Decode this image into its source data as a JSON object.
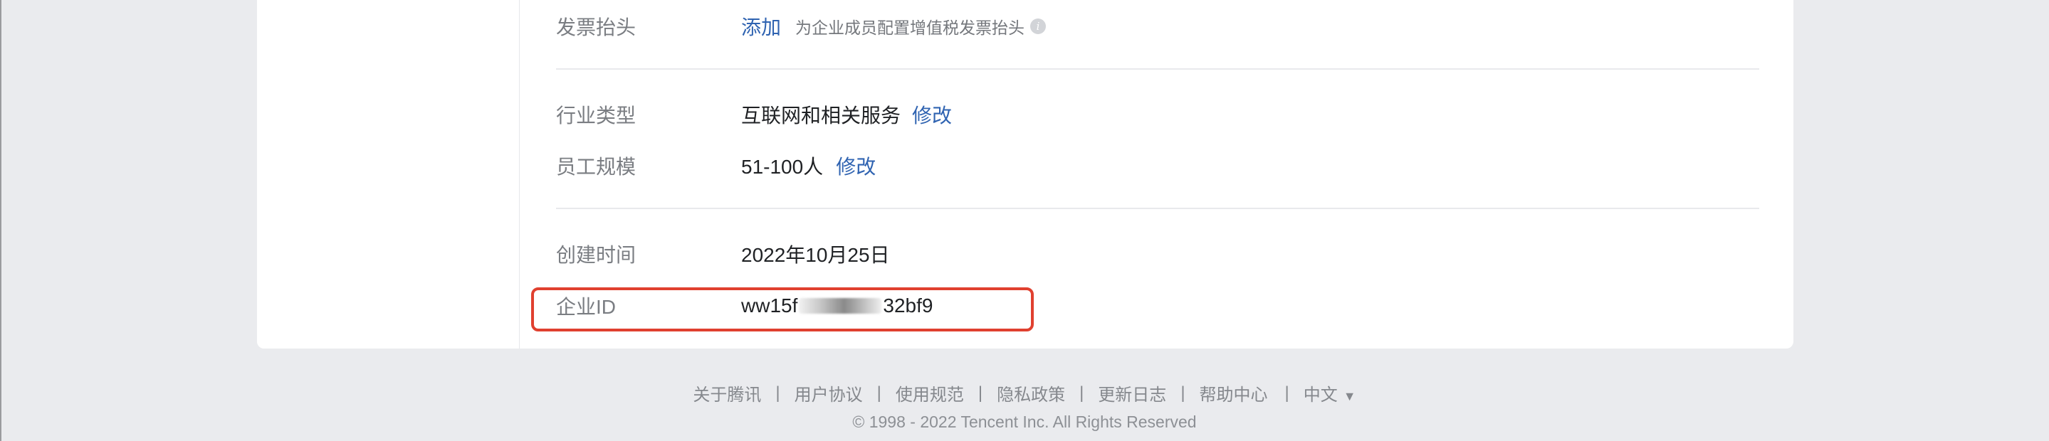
{
  "invoice": {
    "label": "发票抬头",
    "add_link": "添加",
    "hint": "为企业成员配置增值税发票抬头",
    "info_glyph": "i"
  },
  "industry": {
    "label": "行业类型",
    "value": "互联网和相关服务",
    "edit_link": "修改"
  },
  "staff": {
    "label": "员工规模",
    "value": "51-100人",
    "edit_link": "修改"
  },
  "created": {
    "label": "创建时间",
    "value": "2022年10月25日"
  },
  "corp_id": {
    "label": "企业ID",
    "value_prefix": "ww15f",
    "value_suffix": "32bf9",
    "highlight_color": "#e0402f"
  },
  "footer": {
    "links": [
      "关于腾讯",
      "用户协议",
      "使用规范",
      "隐私政策",
      "更新日志",
      "帮助中心"
    ],
    "separator": "|",
    "language": "中文",
    "language_caret": "▼",
    "copyright": "© 1998 - 2022 Tencent Inc. All Rights Reserved"
  },
  "colors": {
    "link": "#2f63b1",
    "background": "#eaebee",
    "card": "#ffffff"
  }
}
